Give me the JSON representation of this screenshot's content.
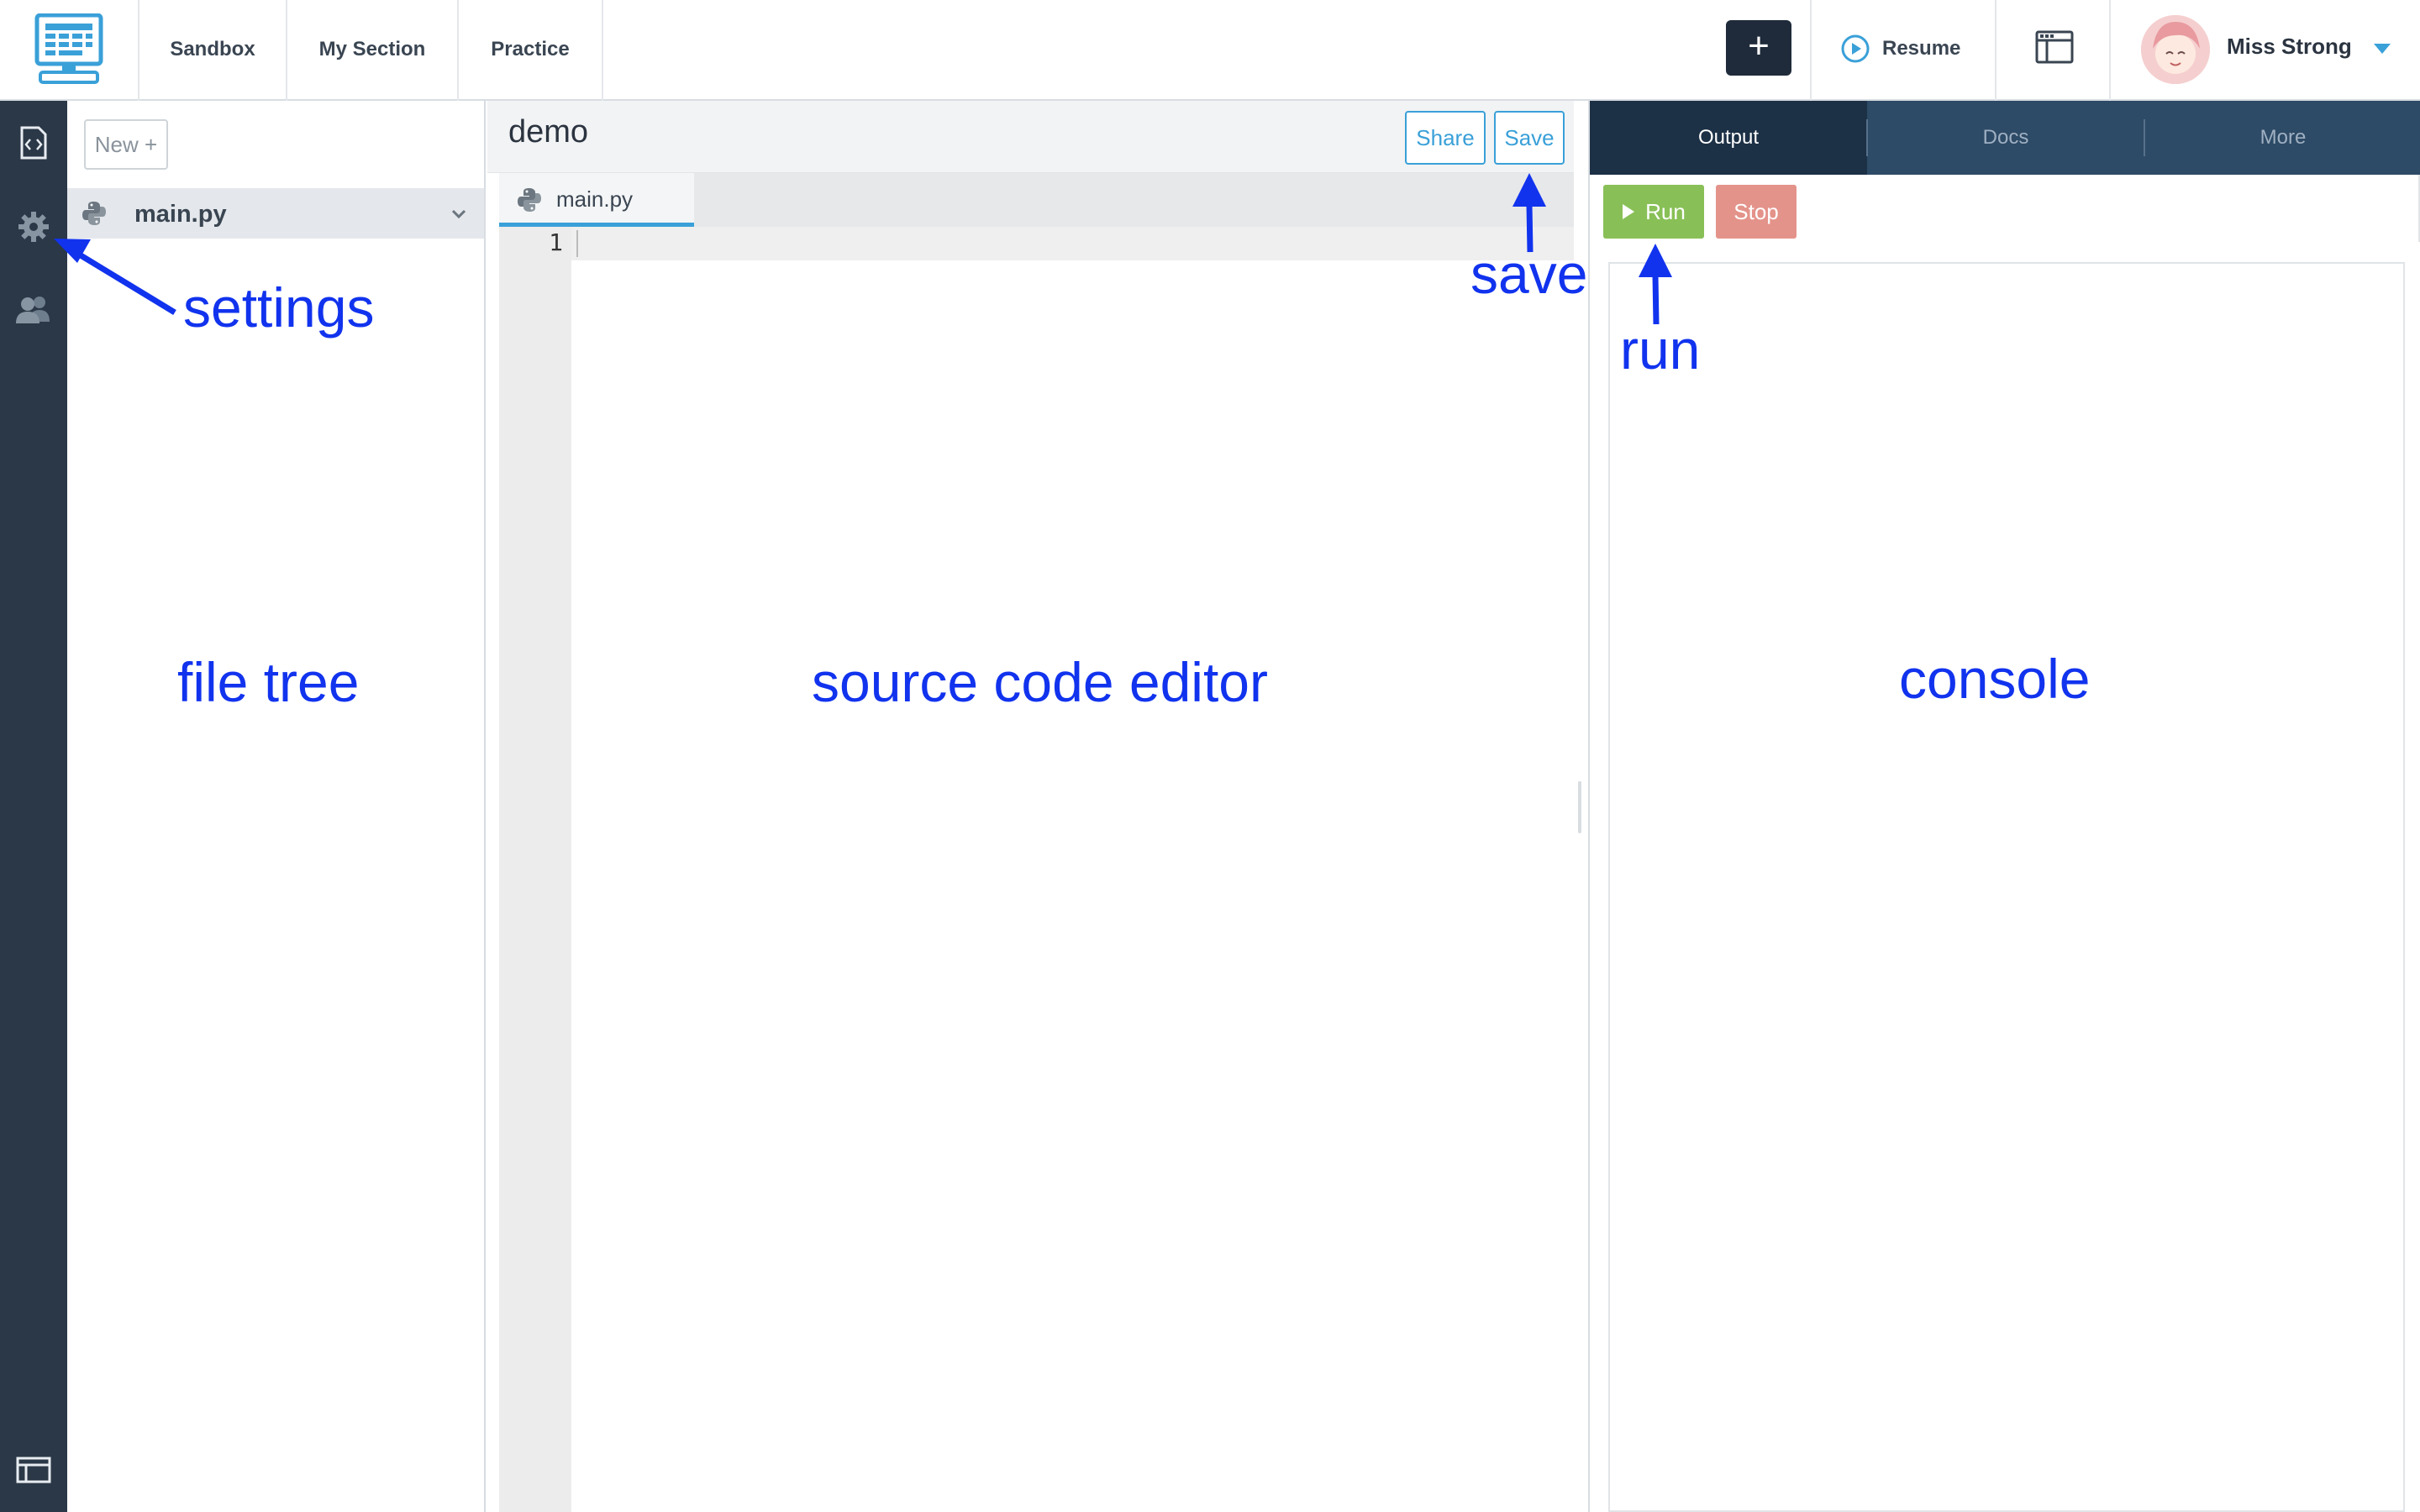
{
  "nav": {
    "links": [
      "Sandbox",
      "My Section",
      "Practice"
    ],
    "add_label": "+",
    "resume_label": "Resume",
    "user_name": "Miss Strong"
  },
  "sidebar": {
    "icons": [
      "code-file-icon",
      "gear-icon",
      "users-icon",
      "layout-icon"
    ]
  },
  "filetree": {
    "new_label": "New +",
    "files": [
      {
        "name": "main.py",
        "icon": "python-icon"
      }
    ]
  },
  "editor": {
    "project_name": "demo",
    "share_label": "Share",
    "save_label": "Save",
    "tabs": [
      {
        "label": "main.py",
        "icon": "python-icon"
      }
    ],
    "line_numbers": [
      "1"
    ]
  },
  "right_panel": {
    "tabs": [
      "Output",
      "Docs",
      "More"
    ],
    "active_tab": "Output",
    "run_label": "Run",
    "stop_label": "Stop"
  },
  "annotations": {
    "settings": "settings",
    "save": "save",
    "run": "run",
    "file_tree": "file tree",
    "source_code_editor": "source code editor",
    "console": "console"
  },
  "colors": {
    "accent": "#3aa0d8",
    "rail": "#2b3847",
    "run": "#88c057",
    "stop": "#e4938a",
    "annotation": "#1133ee",
    "tabs_bg": "#2d4a66",
    "tab_active": "#1c3046"
  }
}
